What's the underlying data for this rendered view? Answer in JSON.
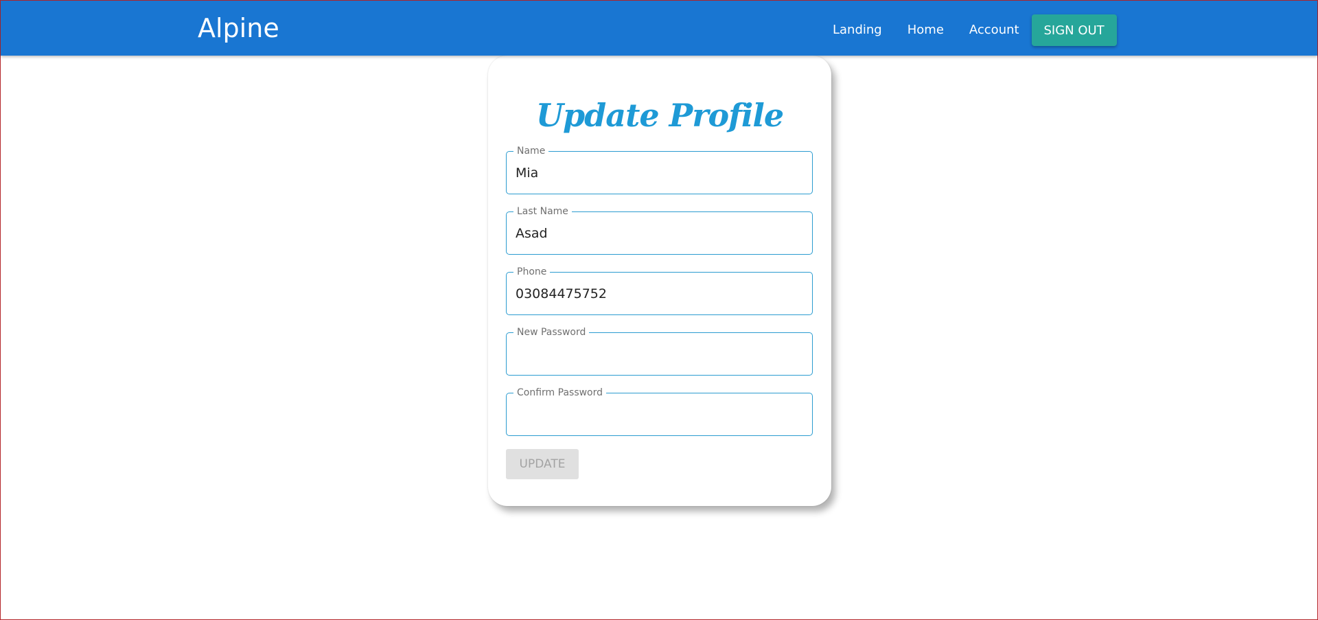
{
  "navbar": {
    "brand": "Alpine",
    "links": [
      "Landing",
      "Home",
      "Account"
    ],
    "signout_label": "SIGN OUT"
  },
  "card": {
    "title": "Update Profile",
    "fields": [
      {
        "label": "Name",
        "value": "Mia"
      },
      {
        "label": "Last Name",
        "value": "Asad"
      },
      {
        "label": "Phone",
        "value": "03084475752"
      },
      {
        "label": "New Password",
        "value": ""
      },
      {
        "label": "Confirm Password",
        "value": ""
      }
    ],
    "update_label": "UPDATE"
  },
  "colors": {
    "navbar": "#1976d2",
    "signout": "#26a69a",
    "title": "#1e9ad6",
    "field_border": "#2a9bd0",
    "update_disabled_bg": "#e0e0e0"
  }
}
